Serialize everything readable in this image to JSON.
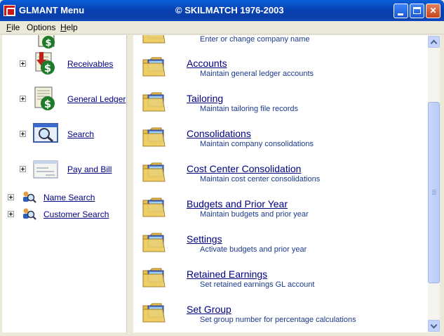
{
  "window": {
    "title": "GLMANT Menu",
    "banner": "© SKILMATCH 1976-2003"
  },
  "menubar": {
    "items": [
      {
        "label": "File",
        "key": "F",
        "rest": "ile"
      },
      {
        "label": "Options",
        "key": "",
        "rest": "Options"
      },
      {
        "label": "Help",
        "key": "H",
        "rest": "elp"
      }
    ]
  },
  "sidebar": {
    "items": [
      {
        "label": "Receivables",
        "icon": "receivables-icon"
      },
      {
        "label": "General Ledger",
        "icon": "general-ledger-icon"
      },
      {
        "label": "Search",
        "icon": "magnifier-icon"
      },
      {
        "label": "Pay and Bill",
        "icon": "check-icon"
      },
      {
        "label": "Name Search",
        "icon": "people-search-icon"
      },
      {
        "label": "Customer Search",
        "icon": "people-search-icon"
      }
    ]
  },
  "main": {
    "partial_desc": "Enter or change company name",
    "items": [
      {
        "title": "Accounts",
        "desc": "Maintain general ledger accounts"
      },
      {
        "title": "Tailoring",
        "desc": "Maintain tailoring file records"
      },
      {
        "title": "Consolidations",
        "desc": "Maintain company consolidations"
      },
      {
        "title": "Cost Center Consolidation",
        "desc": "Maintain cost center consolidations"
      },
      {
        "title": "Budgets and Prior Year",
        "desc": "Maintain budgets and prior year"
      },
      {
        "title": "Settings",
        "desc": "Activate budgets and prior year"
      },
      {
        "title": "Retained Earnings ",
        "desc": "Set retained earnings GL account"
      },
      {
        "title": "Set Group",
        "desc": "Set group number for percentage calculations"
      }
    ]
  },
  "colors": {
    "titlebar": "#0842b5",
    "link": "#000080",
    "description": "#1a3a8a"
  }
}
